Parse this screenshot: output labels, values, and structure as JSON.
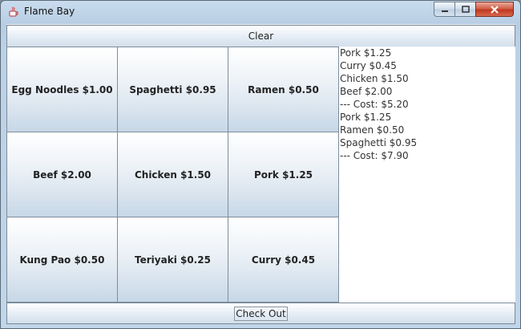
{
  "window": {
    "title": "Flame Bay"
  },
  "buttons": {
    "clear": "Clear",
    "checkout": "Check Out"
  },
  "menu": [
    "Egg Noodles $1.00",
    "Spaghetti $0.95",
    "Ramen $0.50",
    "Beef $2.00",
    "Chicken $1.50",
    "Pork $1.25",
    "Kung Pao $0.50",
    "Teriyaki $0.25",
    "Curry $0.45"
  ],
  "receipt": [
    "Pork $1.25",
    "Curry $0.45",
    "Chicken $1.50",
    "Beef $2.00",
    "--- Cost: $5.20",
    "Pork $1.25",
    "Ramen $0.50",
    "Spaghetti $0.95",
    "--- Cost: $7.90"
  ],
  "icons": {
    "app": "java-coffee-icon",
    "minimize": "minimize-icon",
    "maximize": "maximize-icon",
    "close": "close-icon"
  },
  "colors": {
    "close_button": "#c8452c",
    "window_frame": "#bcd1e6"
  }
}
